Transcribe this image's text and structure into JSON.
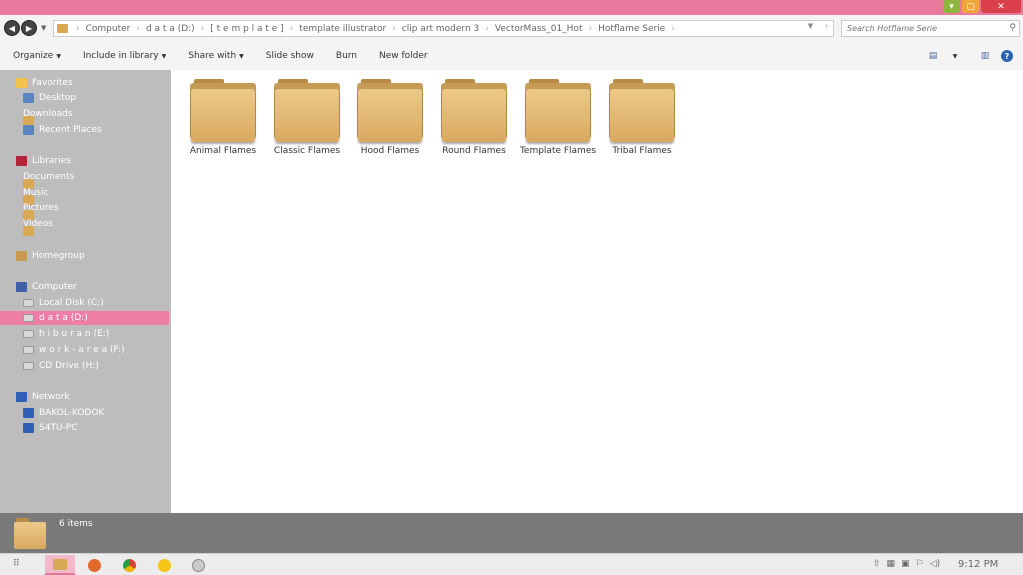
{
  "window": {
    "buttons": {
      "minimize": "▾",
      "maximize": "▢",
      "close": "✕"
    }
  },
  "address": {
    "crumbs": [
      "Computer",
      "d a t a (D:)",
      "[ t e m p l a t e ]",
      "template illustrator",
      "clip art modern 3",
      "VectorMass_01_Hot",
      "Hotflame Serie"
    ],
    "search_placeholder": "Search Hotflame Serie"
  },
  "toolbar": {
    "organize": "Organize",
    "include": "Include in library",
    "share": "Share with",
    "slideshow": "Slide show",
    "burn": "Burn",
    "newfolder": "New folder"
  },
  "sidebar": {
    "favorites": {
      "label": "Favorites",
      "items": [
        "Desktop",
        "Downloads",
        "Recent Places"
      ]
    },
    "libraries": {
      "label": "Libraries",
      "items": [
        "Documents",
        "Music",
        "Pictures",
        "Videos"
      ]
    },
    "homegroup": "Homegroup",
    "computer": {
      "label": "Computer",
      "items": [
        "Local Disk (C:)",
        "d a t a (D:)",
        "h i b u r a n (E:)",
        "w o r k - a r e a (F:)",
        "CD Drive (H:)"
      ],
      "selected": "d a t a (D:)"
    },
    "network": {
      "label": "Network",
      "items": [
        "BAKOL-KODOK",
        "S4TU-PC"
      ]
    }
  },
  "folders": [
    "Animal Flames",
    "Classic Flames",
    "Hood Flames",
    "Round Flames",
    "Template Flames",
    "Tribal Flames"
  ],
  "details": {
    "count": "6 items"
  },
  "taskbar": {
    "clock": "9:12 PM"
  },
  "colors": {
    "titlebar": "#e9799d",
    "selection": "#ee7ea6",
    "sidebar": "#bdbdbd",
    "folder": "#d9a955"
  }
}
